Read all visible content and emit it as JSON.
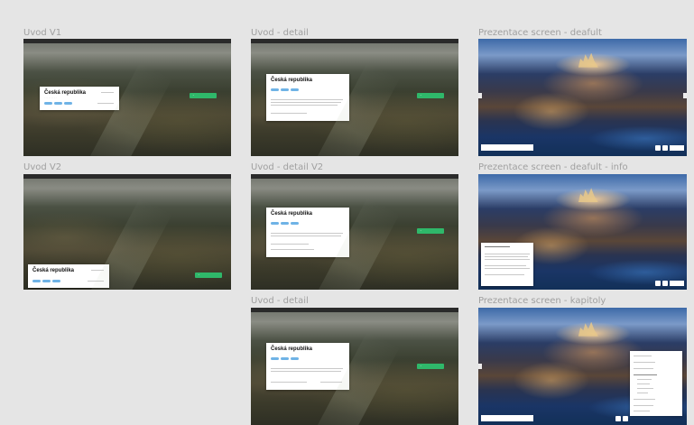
{
  "frames": {
    "uvod_v1": "Uvod V1",
    "uvod_detail": "Uvod - detail",
    "prez_default": "Prezentace screen - deafult",
    "uvod_v2": "Uvod V2",
    "uvod_detail_v2": "Uvod - detail V2",
    "prez_default_info": "Prezentace screen - deafult - info",
    "uvod_detail_3": "Uvod - detail",
    "prez_kapitoly": "Prezentace screen - kapitoly"
  },
  "card": {
    "title": "Česká republika"
  },
  "colors": {
    "canvas": "#e5e5e5",
    "accent_green": "#2fb86a",
    "tag_blue": "#6fb3e6"
  }
}
